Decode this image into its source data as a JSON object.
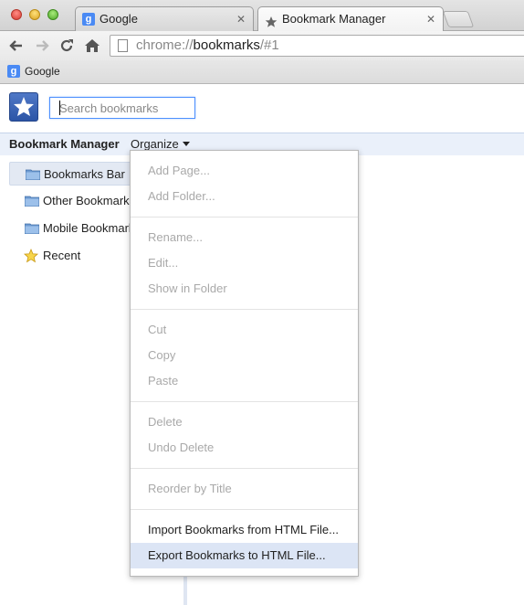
{
  "tabs": [
    {
      "title": "Google",
      "favicon": "google-g-icon"
    },
    {
      "title": "Bookmark Manager",
      "favicon": "star-icon",
      "active": true
    }
  ],
  "toolbar": {
    "url_prefix": "chrome://",
    "url_host": "bookmarks",
    "url_path": "/#1"
  },
  "bookmarks_bar": {
    "items": [
      {
        "label": "Google",
        "favicon": "google-g-icon"
      }
    ]
  },
  "manager": {
    "search_placeholder": "Search bookmarks",
    "title": "Bookmark Manager",
    "organize_label": "Organize"
  },
  "tree": {
    "items": [
      {
        "label": "Bookmarks Bar",
        "icon": "folder-icon",
        "selected": true
      },
      {
        "label": "Other Bookmarks",
        "icon": "folder-icon"
      },
      {
        "label": "Mobile Bookmarks",
        "icon": "folder-icon"
      },
      {
        "label": "Recent",
        "icon": "star-icon"
      }
    ]
  },
  "organize_menu": {
    "items": [
      {
        "label": "Add Page...",
        "enabled": false
      },
      {
        "label": "Add Folder...",
        "enabled": false
      },
      {
        "label": "Rename...",
        "enabled": false
      },
      {
        "label": "Edit...",
        "enabled": false
      },
      {
        "label": "Show in Folder",
        "enabled": false
      },
      {
        "label": "Cut",
        "enabled": false
      },
      {
        "label": "Copy",
        "enabled": false
      },
      {
        "label": "Paste",
        "enabled": false
      },
      {
        "label": "Delete",
        "enabled": false
      },
      {
        "label": "Undo Delete",
        "enabled": false
      },
      {
        "label": "Reorder by Title",
        "enabled": false
      },
      {
        "label": "Import Bookmarks from HTML File...",
        "enabled": true
      },
      {
        "label": "Export Bookmarks to HTML File...",
        "enabled": true,
        "highlighted": true
      }
    ]
  },
  "colors": {
    "manager_bar": "#eaf0fa",
    "menu_highlight": "#dce5f5",
    "disabled_text": "#a9a9a9",
    "search_focus": "#4d90fe"
  }
}
